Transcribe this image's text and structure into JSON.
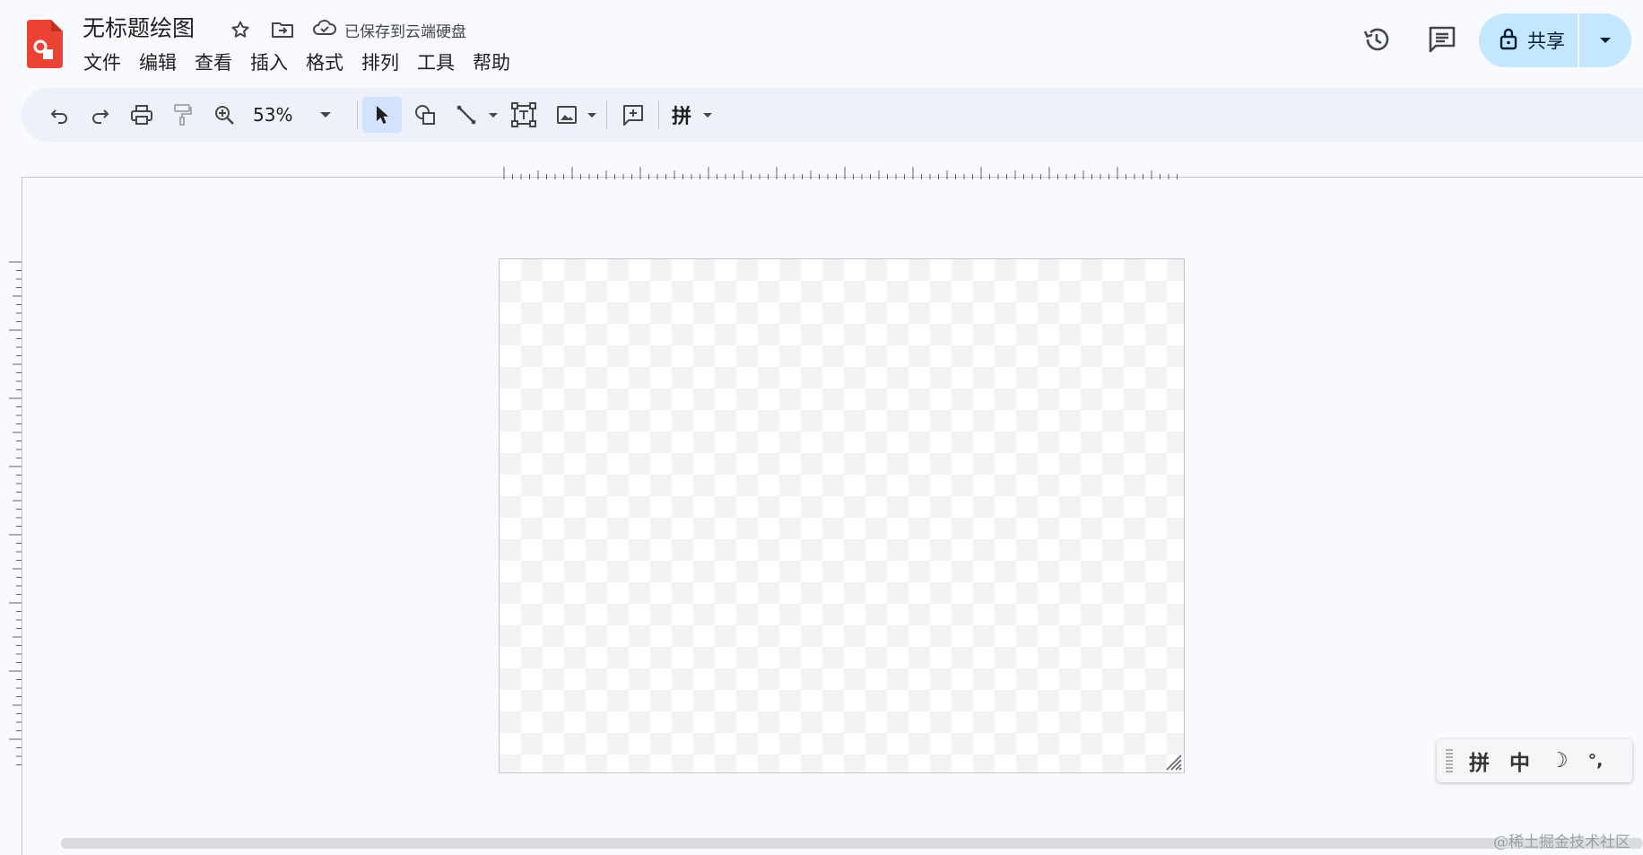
{
  "header": {
    "doc_title": "无标题绘图",
    "save_status": "已保存到云端硬盘",
    "share_label": "共享"
  },
  "menu": [
    "文件",
    "编辑",
    "查看",
    "插入",
    "格式",
    "排列",
    "工具",
    "帮助"
  ],
  "toolbar": {
    "zoom_value": "53%",
    "input_tool_label": "拼"
  },
  "ime_bar": {
    "pinyin": "拼",
    "chinese": "中",
    "half_width": "☽",
    "punctuation": "°,"
  },
  "watermark": "@稀土掘金技术社区",
  "colors": {
    "app_icon": "#ea4335",
    "share_bg": "#c2e7ff",
    "toolbar_bg": "#edf2fa",
    "select_active": "#d3e3fd",
    "page_bg": "#f8fafd"
  },
  "icons": {
    "app": "drawings-logo-icon",
    "star": "star-icon",
    "move": "folder-move-icon",
    "cloud": "cloud-saved-icon",
    "history": "history-icon",
    "comments": "comment-icon",
    "share_lock": "lock-icon"
  }
}
